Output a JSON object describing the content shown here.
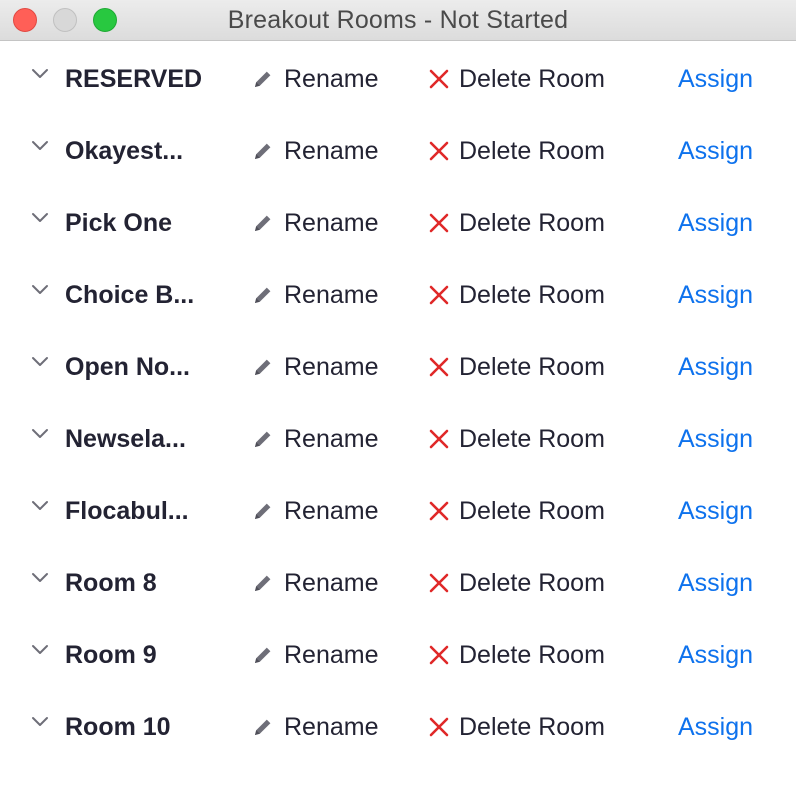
{
  "window": {
    "title": "Breakout Rooms - Not Started"
  },
  "actions": {
    "rename_label": "Rename",
    "delete_label": "Delete Room",
    "assign_label": "Assign"
  },
  "rooms": [
    {
      "name": "RESERVED"
    },
    {
      "name": "Okayest..."
    },
    {
      "name": "Pick One"
    },
    {
      "name": "Choice B..."
    },
    {
      "name": "Open No..."
    },
    {
      "name": "Newsela..."
    },
    {
      "name": "Flocabul..."
    },
    {
      "name": "Room 8"
    },
    {
      "name": "Room 9"
    },
    {
      "name": "Room 10"
    }
  ],
  "icons": {
    "expand": "chevron-down-icon",
    "rename": "pencil-icon",
    "delete": "x-icon"
  },
  "colors": {
    "accent": "#0e72ed",
    "delete": "#e02828",
    "text": "#232333",
    "icon": "#6e6e78"
  }
}
